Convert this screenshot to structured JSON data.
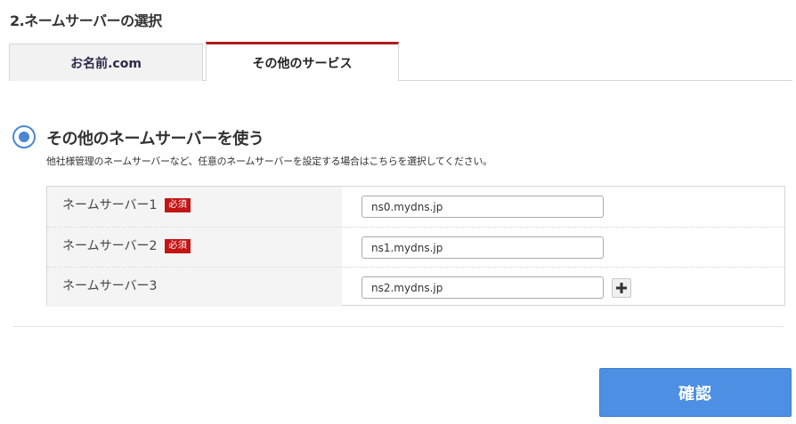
{
  "section": {
    "title": "2.ネームサーバーの選択"
  },
  "tabs": [
    {
      "label": "お名前.com",
      "active": false
    },
    {
      "label": "その他のサービス",
      "active": true
    }
  ],
  "option": {
    "label": "その他のネームサーバーを使う",
    "description": "他社様管理のネームサーバーなど、任意のネームサーバーを設定する場合はこちらを選択してください。",
    "selected": true
  },
  "nameservers": [
    {
      "label": "ネームサーバー1",
      "required_badge": "必須",
      "value": "ns0.mydns.jp"
    },
    {
      "label": "ネームサーバー2",
      "required_badge": "必須",
      "value": "ns1.mydns.jp"
    },
    {
      "label": "ネームサーバー3",
      "value": "ns2.mydns.jp",
      "add_icon": "plus-icon"
    }
  ],
  "confirm": {
    "label": "確認"
  },
  "colors": {
    "accent": "#4d8fe3",
    "tab_active_border": "#b01c1c",
    "required_badge": "#c41414"
  }
}
